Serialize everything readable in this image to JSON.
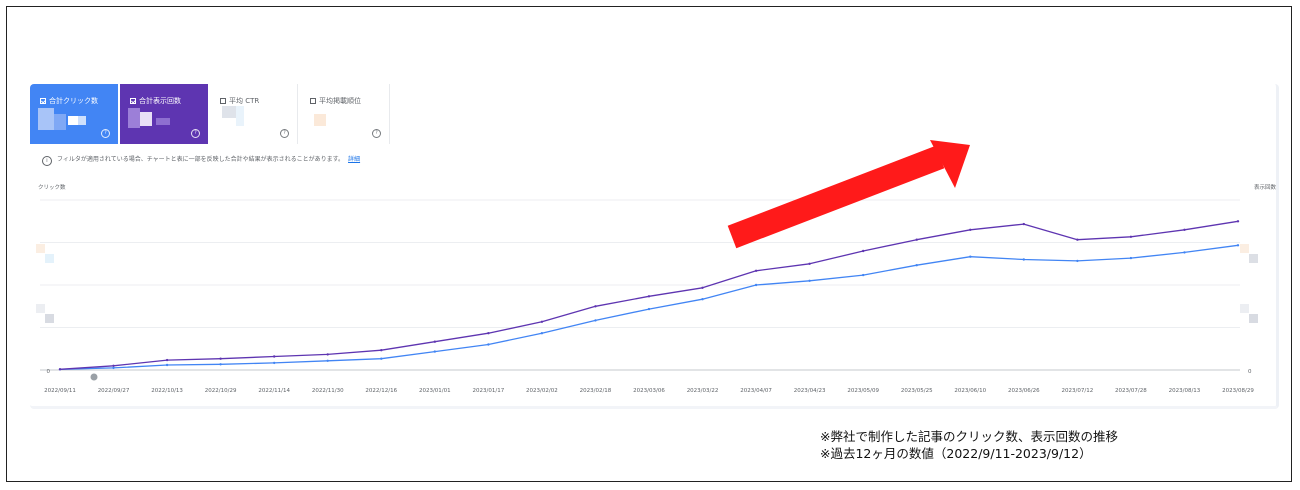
{
  "scorecards": [
    {
      "label": "合計クリック数",
      "help": "?"
    },
    {
      "label": "合計表示回数",
      "help": "?"
    },
    {
      "label": "平均 CTR",
      "help": "?"
    },
    {
      "label": "平均掲載順位",
      "help": "?"
    }
  ],
  "notice": {
    "icon": "i",
    "text": "フィルタが適用されている場合、チャートと表に一部を反映した合計や結果が表示されることがあります。",
    "link": "詳細"
  },
  "colors": {
    "clicks": "#4285f4",
    "impressions": "#5e35b1",
    "arrow": "#ff1a1a"
  },
  "caption": {
    "line1": "※弊社で制作した記事のクリック数、表示回数の推移",
    "line2": "※過去12ヶ月の数値（2022/9/11-2023/9/12）"
  },
  "chart_data": {
    "type": "line",
    "ylabel_left": "クリック数",
    "ylabel_right": "表示回数",
    "left_zero_label": "0",
    "right_zero_label": "0",
    "grid": true,
    "legend": "top-left",
    "categories": [
      "2022/09/11",
      "2022/09/27",
      "2022/10/13",
      "2022/10/29",
      "2022/11/14",
      "2022/11/30",
      "2022/12/16",
      "2023/01/01",
      "2023/01/17",
      "2023/02/02",
      "2023/02/18",
      "2023/03/06",
      "2023/03/22",
      "2023/04/07",
      "2023/04/23",
      "2023/05/09",
      "2023/05/25",
      "2023/06/10",
      "2023/06/26",
      "2023/07/12",
      "2023/07/28",
      "2023/08/13",
      "2023/08/29"
    ],
    "series": [
      {
        "name": "クリック数",
        "values": [
          0.5,
          1.5,
          3.5,
          4,
          5,
          6.5,
          8,
          13,
          18,
          26,
          35,
          43,
          50,
          60,
          63,
          67,
          74,
          80,
          78,
          77,
          79,
          83,
          88
        ]
      },
      {
        "name": "表示回数",
        "values": [
          0.5,
          3,
          7,
          8,
          9.5,
          11,
          14,
          20,
          26,
          34,
          45,
          52,
          58,
          70,
          75,
          84,
          92,
          99,
          103,
          92,
          94,
          99,
          105
        ]
      }
    ],
    "ylim": [
      0,
      120
    ]
  }
}
